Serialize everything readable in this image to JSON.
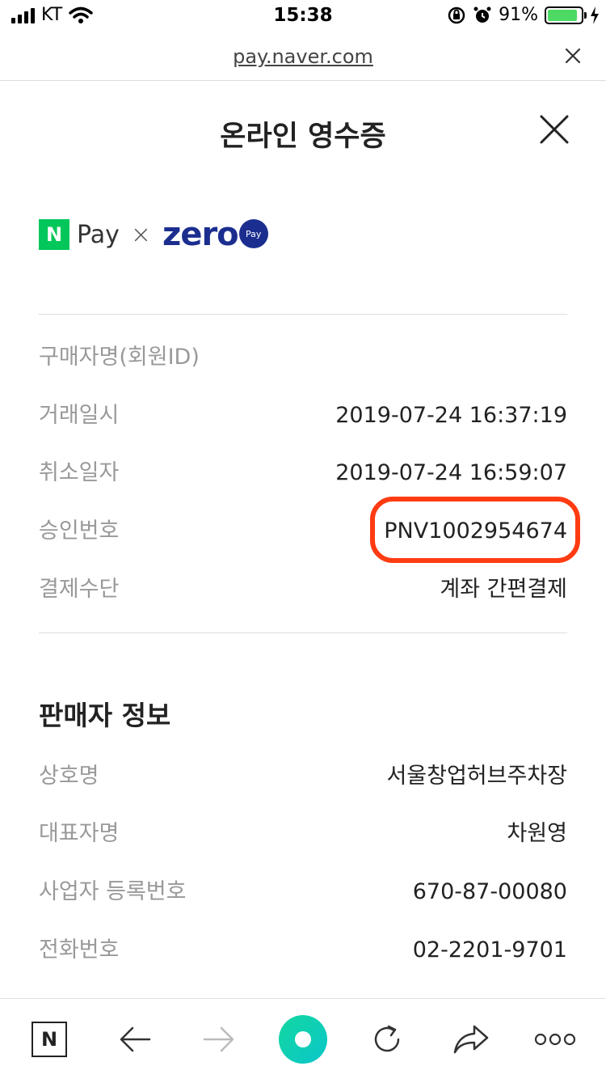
{
  "status_bar": {
    "carrier": "KT",
    "time": "15:38",
    "battery_percent": "91%",
    "battery_level": 0.91
  },
  "browser": {
    "url": "pay.naver.com"
  },
  "header": {
    "title": "온라인 영수증"
  },
  "logos": {
    "npay_mark": "N",
    "npay_text": "Pay",
    "separator": "×",
    "zero_text": "zero",
    "zero_badge": "Pay"
  },
  "transaction": {
    "rows": [
      {
        "label": "구매자명(회원ID)",
        "value": ""
      },
      {
        "label": "거래일시",
        "value": "2019-07-24 16:37:19"
      },
      {
        "label": "취소일자",
        "value": "2019-07-24 16:59:07"
      },
      {
        "label": "승인번호",
        "value": "PNV1002954674"
      },
      {
        "label": "결제수단",
        "value": "계좌 간편결제"
      }
    ]
  },
  "seller": {
    "title": "판매자 정보",
    "rows": [
      {
        "label": "상호명",
        "value": "서울창업허브주차장"
      },
      {
        "label": "대표자명",
        "value": "차원영"
      },
      {
        "label": "사업자 등록번호",
        "value": "670-87-00080"
      },
      {
        "label": "전화번호",
        "value": "02-2201-9701"
      }
    ]
  },
  "toolbar": {
    "naver_label": "N"
  },
  "colors": {
    "naver_green": "#03c75a",
    "zero_blue": "#1b2e8f",
    "highlight_red": "#ff3b12",
    "home_button": "#12d8a0"
  }
}
